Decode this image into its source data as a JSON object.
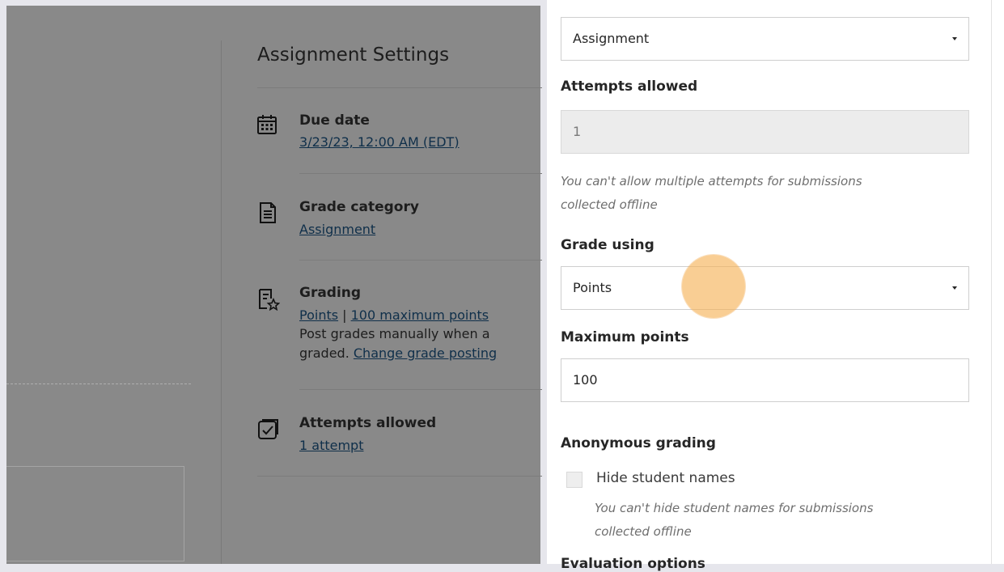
{
  "settings": {
    "title": "Assignment Settings",
    "due_date": {
      "label": "Due date",
      "value": "3/23/23, 12:00 AM (EDT)",
      "icon": "calendar-icon"
    },
    "grade_category": {
      "label": "Grade category",
      "value": "Assignment",
      "icon": "document-icon"
    },
    "grading": {
      "label": "Grading",
      "points_link": "Points",
      "separator": " | ",
      "max_link": "100 maximum points",
      "desc_line1": "Post grades manually when a",
      "desc_prefix": "graded. ",
      "change_link": "Change grade posting",
      "icon": "grading-star-icon"
    },
    "attempts": {
      "label": "Attempts allowed",
      "value": "1 attempt",
      "icon": "checkbox-icon"
    }
  },
  "panel": {
    "category_select": "Assignment",
    "attempts_label": "Attempts allowed",
    "attempts_value": "1",
    "attempts_hint_1": "You can't allow multiple attempts for submissions",
    "attempts_hint_2": "collected offline",
    "grade_using_label": "Grade using",
    "grade_using_value": "Points",
    "max_points_label": "Maximum points",
    "max_points_value": "100",
    "anon_label": "Anonymous grading",
    "hide_names_label": "Hide student names",
    "hide_hint_1": "You can't hide student names for submissions",
    "hide_hint_2": "collected offline",
    "next_label": "Evaluation options"
  },
  "colors": {
    "overlay": "#898989",
    "panel": "#ffffff",
    "click_marker": "#f6b052"
  }
}
